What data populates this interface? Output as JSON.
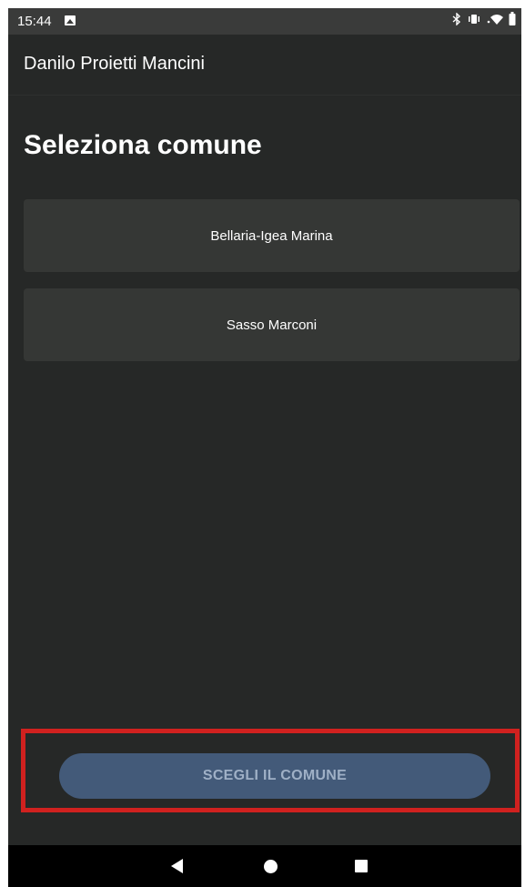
{
  "status_bar": {
    "time": "15:44",
    "icons": [
      "image-icon",
      "bluetooth-icon",
      "vibrate-icon",
      "wifi-icon",
      "battery-icon"
    ]
  },
  "app_bar": {
    "title": "Danilo Proietti Mancini"
  },
  "page": {
    "title": "Seleziona comune"
  },
  "comuni": [
    {
      "label": "Bellaria-Igea Marina"
    },
    {
      "label": "Sasso Marconi"
    }
  ],
  "footer": {
    "button_label": "SCEGLI IL COMUNE"
  },
  "nav_bar": {
    "icons": [
      "back-icon",
      "home-icon",
      "recents-icon"
    ]
  },
  "colors": {
    "background": "#262827",
    "list_item": "#353735",
    "button": "#435a79",
    "button_text": "#9fb0c6",
    "highlight": "#d0211f"
  }
}
